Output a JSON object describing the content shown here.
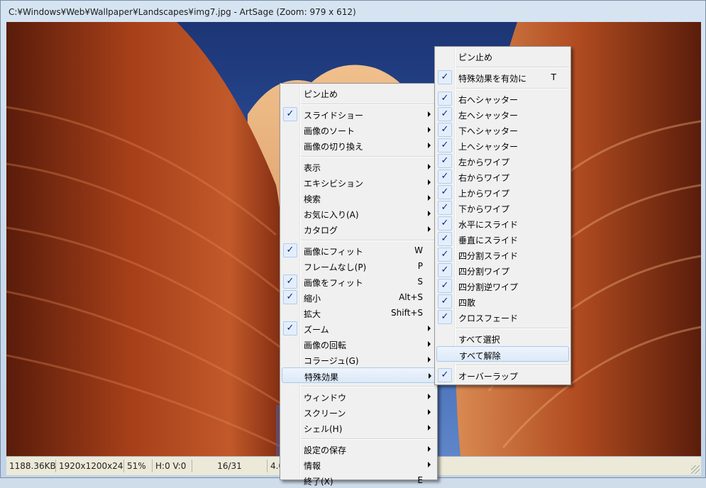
{
  "window": {
    "title": "C:¥Windows¥Web¥Wallpaper¥Landscapes¥img7.jpg - ArtSage (Zoom: 979 x 612)"
  },
  "statusbar": {
    "filesize": "1188.36KB",
    "dimensions": "1920x1200x24",
    "zoom": "51%",
    "position": "H:0 V:0",
    "index": "16/31",
    "extra": "4.0"
  },
  "main_menu": {
    "items": [
      {
        "label": "ピン止め",
        "checked": false,
        "shortcut": "",
        "submenu": false
      },
      {
        "label": "スライドショー",
        "checked": true,
        "shortcut": "",
        "submenu": true
      },
      {
        "label": "画像のソート",
        "checked": false,
        "shortcut": "",
        "submenu": true
      },
      {
        "label": "画像の切り換え",
        "checked": false,
        "shortcut": "",
        "submenu": true
      },
      {
        "label": "表示",
        "checked": false,
        "shortcut": "",
        "submenu": true
      },
      {
        "label": "エキシビション",
        "checked": false,
        "shortcut": "",
        "submenu": true
      },
      {
        "label": "検索",
        "checked": false,
        "shortcut": "",
        "submenu": true
      },
      {
        "label": "お気に入り(A)",
        "checked": false,
        "shortcut": "",
        "submenu": true
      },
      {
        "label": "カタログ",
        "checked": false,
        "shortcut": "",
        "submenu": true
      },
      {
        "label": "画像にフィット",
        "checked": true,
        "shortcut": "W",
        "submenu": false
      },
      {
        "label": "フレームなし(P)",
        "checked": false,
        "shortcut": "P",
        "submenu": false
      },
      {
        "label": "画像をフィット",
        "checked": true,
        "shortcut": "S",
        "submenu": false
      },
      {
        "label": "縮小",
        "checked": true,
        "shortcut": "Alt+S",
        "submenu": false
      },
      {
        "label": "拡大",
        "checked": false,
        "shortcut": "Shift+S",
        "submenu": false
      },
      {
        "label": "ズーム",
        "checked": true,
        "shortcut": "",
        "submenu": true
      },
      {
        "label": "画像の回転",
        "checked": false,
        "shortcut": "",
        "submenu": true
      },
      {
        "label": "コラージュ(G)",
        "checked": false,
        "shortcut": "",
        "submenu": true
      },
      {
        "label": "特殊効果",
        "checked": false,
        "shortcut": "",
        "submenu": true
      },
      {
        "label": "ウィンドウ",
        "checked": false,
        "shortcut": "",
        "submenu": true
      },
      {
        "label": "スクリーン",
        "checked": false,
        "shortcut": "",
        "submenu": true
      },
      {
        "label": "シェル(H)",
        "checked": false,
        "shortcut": "",
        "submenu": true
      },
      {
        "label": "設定の保存",
        "checked": false,
        "shortcut": "",
        "submenu": true
      },
      {
        "label": "情報",
        "checked": false,
        "shortcut": "",
        "submenu": true
      },
      {
        "label": "終了(X)",
        "checked": false,
        "shortcut": "E",
        "submenu": false
      }
    ]
  },
  "effects_menu": {
    "items": [
      {
        "label": "ピン止め",
        "checked": false,
        "shortcut": ""
      },
      {
        "label": "特殊効果を有効に",
        "checked": true,
        "shortcut": "T"
      },
      {
        "label": "右へシャッター",
        "checked": true,
        "shortcut": ""
      },
      {
        "label": "左へシャッター",
        "checked": true,
        "shortcut": ""
      },
      {
        "label": "下へシャッター",
        "checked": true,
        "shortcut": ""
      },
      {
        "label": "上へシャッター",
        "checked": true,
        "shortcut": ""
      },
      {
        "label": "左からワイプ",
        "checked": true,
        "shortcut": ""
      },
      {
        "label": "右からワイプ",
        "checked": true,
        "shortcut": ""
      },
      {
        "label": "上からワイプ",
        "checked": true,
        "shortcut": ""
      },
      {
        "label": "下からワイプ",
        "checked": true,
        "shortcut": ""
      },
      {
        "label": "水平にスライド",
        "checked": true,
        "shortcut": ""
      },
      {
        "label": "垂直にスライド",
        "checked": true,
        "shortcut": ""
      },
      {
        "label": "四分割スライド",
        "checked": true,
        "shortcut": ""
      },
      {
        "label": "四分割ワイプ",
        "checked": true,
        "shortcut": ""
      },
      {
        "label": "四分割逆ワイプ",
        "checked": true,
        "shortcut": ""
      },
      {
        "label": "四散",
        "checked": true,
        "shortcut": ""
      },
      {
        "label": "クロスフェード",
        "checked": true,
        "shortcut": ""
      },
      {
        "label": "すべて選択",
        "checked": false,
        "shortcut": ""
      },
      {
        "label": "すべて解除",
        "checked": false,
        "shortcut": ""
      },
      {
        "label": "オーバーラップ",
        "checked": true,
        "shortcut": ""
      }
    ]
  },
  "check_glyph": "✓",
  "colors": {
    "menu_bg": "#f0f0f0",
    "highlight": "#dce9f8",
    "check": "#0c2a74"
  }
}
